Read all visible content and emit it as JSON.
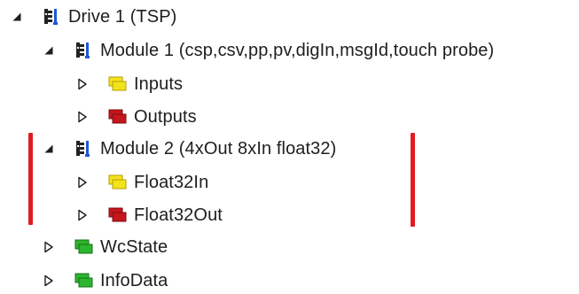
{
  "tree": {
    "drive": {
      "label": "Drive 1 (TSP)",
      "expanded": true,
      "icon": "drive-module-icon"
    },
    "module1": {
      "label": "Module 1 (csp,csv,pp,pv,digIn,msgId,touch probe)",
      "expanded": true,
      "icon": "drive-module-icon"
    },
    "inputs": {
      "label": "Inputs",
      "expanded": false,
      "icon": "yellow-input-icon"
    },
    "outputs": {
      "label": "Outputs",
      "expanded": false,
      "icon": "red-output-icon"
    },
    "module2": {
      "label": "Module 2 (4xOut 8xIn float32)",
      "expanded": true,
      "icon": "drive-module-icon"
    },
    "float32in": {
      "label": "Float32In",
      "expanded": false,
      "icon": "yellow-input-icon"
    },
    "float32out": {
      "label": "Float32Out",
      "expanded": false,
      "icon": "red-output-icon"
    },
    "wcstate": {
      "label": "WcState",
      "expanded": false,
      "icon": "green-status-icon"
    },
    "infodata": {
      "label": "InfoData",
      "expanded": false,
      "icon": "green-status-icon"
    }
  },
  "colors": {
    "highlight_marker": "#e01b22",
    "input_icon": "#f2e21a",
    "output_icon": "#c4161c",
    "status_icon": "#2db52d",
    "text": "#1e1e1e"
  }
}
